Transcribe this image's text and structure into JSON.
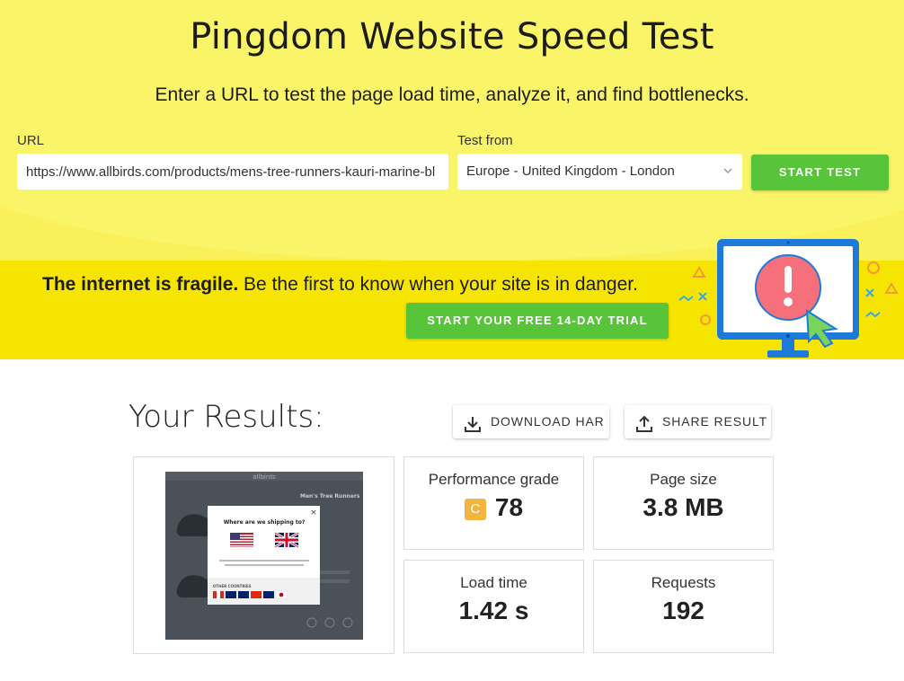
{
  "hero": {
    "title": "Pingdom Website Speed Test",
    "subtitle": "Enter a URL to test the page load time, analyze it, and find bottlenecks.",
    "url_label": "URL",
    "url_value": "https://www.allbirds.com/products/mens-tree-runners-kauri-marine-bl",
    "test_from_label": "Test from",
    "test_from_value": "Europe - United Kingdom - London",
    "start_test_label": "START TEST"
  },
  "banner": {
    "bold": "The internet is fragile.",
    "text": " Be the first to know when your site is in danger.",
    "cta_label": "START YOUR FREE 14-DAY TRIAL"
  },
  "results": {
    "title": "Your Results:",
    "download_label": "DOWNLOAD HAR",
    "share_label": "SHARE RESULT",
    "screenshot": {
      "brand": "allbirds",
      "product": "Men's Tree Runners",
      "popup_title": "Where are we shipping to?",
      "popup_text": "Purchasing from your country's website is the best way to connect your feet to the world's most comfortable shoe.",
      "other_countries": "OTHER COUNTRIES"
    },
    "performance": {
      "label": "Performance grade",
      "grade": "C",
      "value": "78"
    },
    "page_size": {
      "label": "Page size",
      "value": "3.8 MB"
    },
    "load_time": {
      "label": "Load time",
      "value": "1.42 s"
    },
    "requests": {
      "label": "Requests",
      "value": "192"
    }
  },
  "colors": {
    "hero_yellow": "#f9f05a",
    "banner_yellow": "#f6e500",
    "green": "#57c43a",
    "grade_orange": "#f3b53f"
  }
}
